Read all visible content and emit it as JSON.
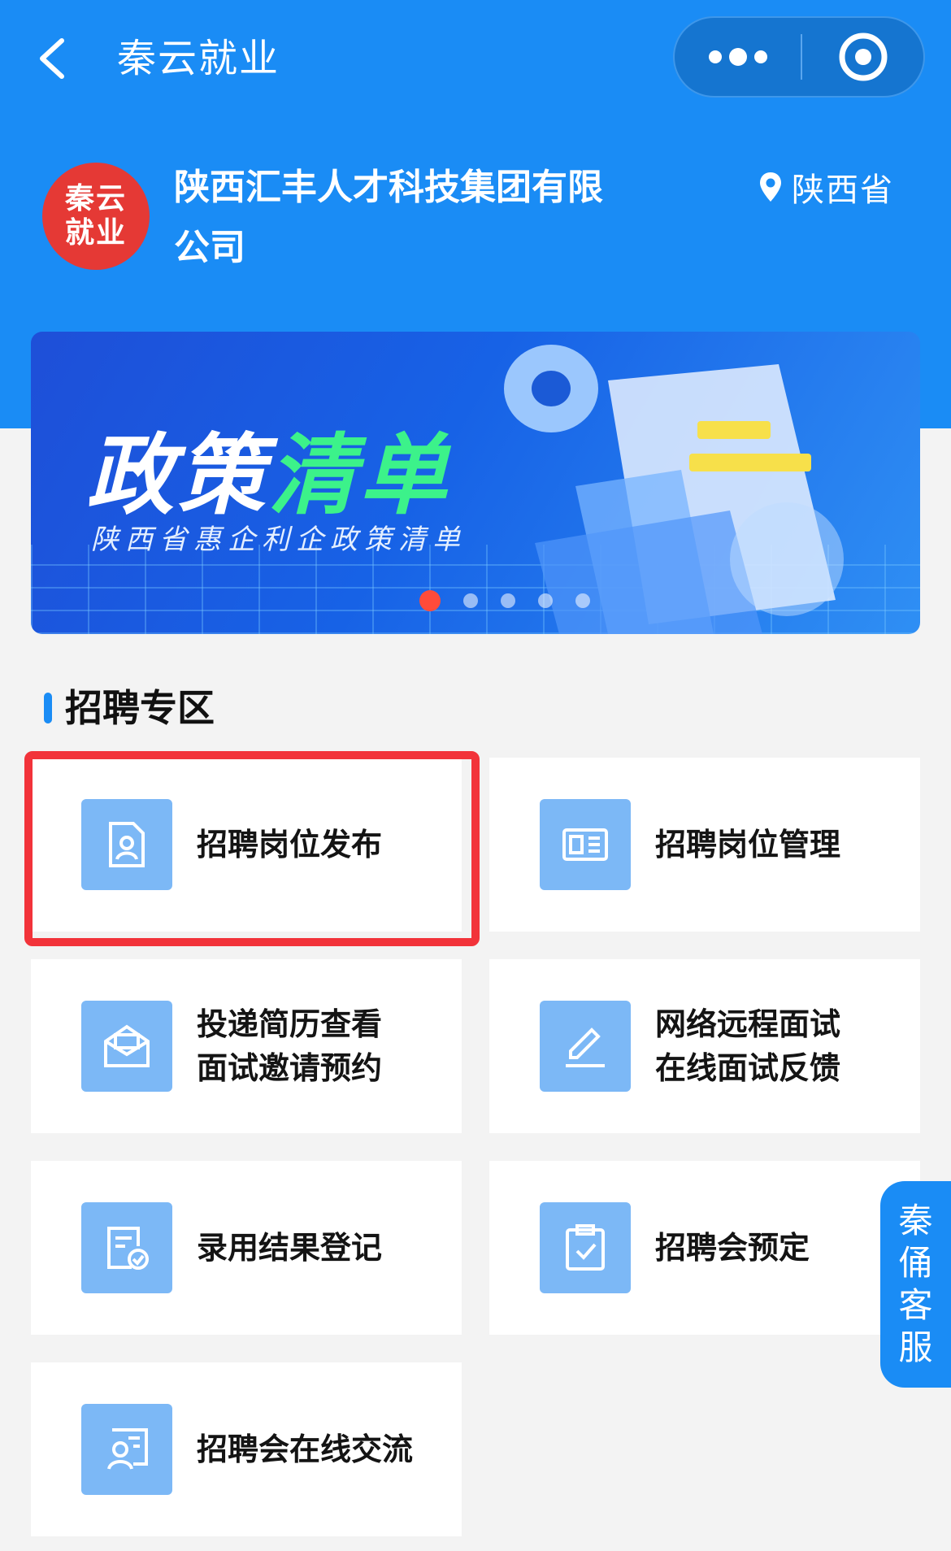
{
  "nav": {
    "title": "秦云就业",
    "icons": {
      "back": "chevron-left-icon",
      "more": "more-dots-icon",
      "close": "target-circle-icon"
    }
  },
  "company": {
    "logo_line1": "秦云",
    "logo_line2": "就业",
    "name_line1": "陕西汇丰人才科技集团有限",
    "name_line2": "公司",
    "location": "陕西省",
    "location_icon": "location-pin-icon"
  },
  "banner": {
    "title_white": "政策",
    "title_green": "清单",
    "subtitle": "陕西省惠企利企政策清单",
    "slide_count": 5,
    "active_slide": 1
  },
  "recruit": {
    "section_title": "招聘专区",
    "cards": [
      {
        "line1": "招聘岗位发布",
        "line2": "",
        "icon": "resume-person-icon"
      },
      {
        "line1": "招聘岗位管理",
        "line2": "",
        "icon": "id-card-icon"
      },
      {
        "line1": "投递简历查看",
        "line2": "面试邀请预约",
        "icon": "envelope-icon"
      },
      {
        "line1": "网络远程面试",
        "line2": "在线面试反馈",
        "icon": "edit-pen-icon"
      },
      {
        "line1": "录用结果登记",
        "line2": "",
        "icon": "document-check-icon"
      },
      {
        "line1": "招聘会预定",
        "line2": "",
        "icon": "clipboard-check-icon"
      },
      {
        "line1": "招聘会在线交流",
        "line2": "",
        "icon": "chat-person-icon"
      }
    ]
  },
  "service": {
    "c1": "秦",
    "c2": "俑",
    "c3": "客",
    "c4": "服"
  },
  "colors": {
    "primary": "#1a8cf5",
    "highlight": "#f2333a",
    "icon_bg": "#7cb8f6",
    "logo_red": "#e53935"
  }
}
